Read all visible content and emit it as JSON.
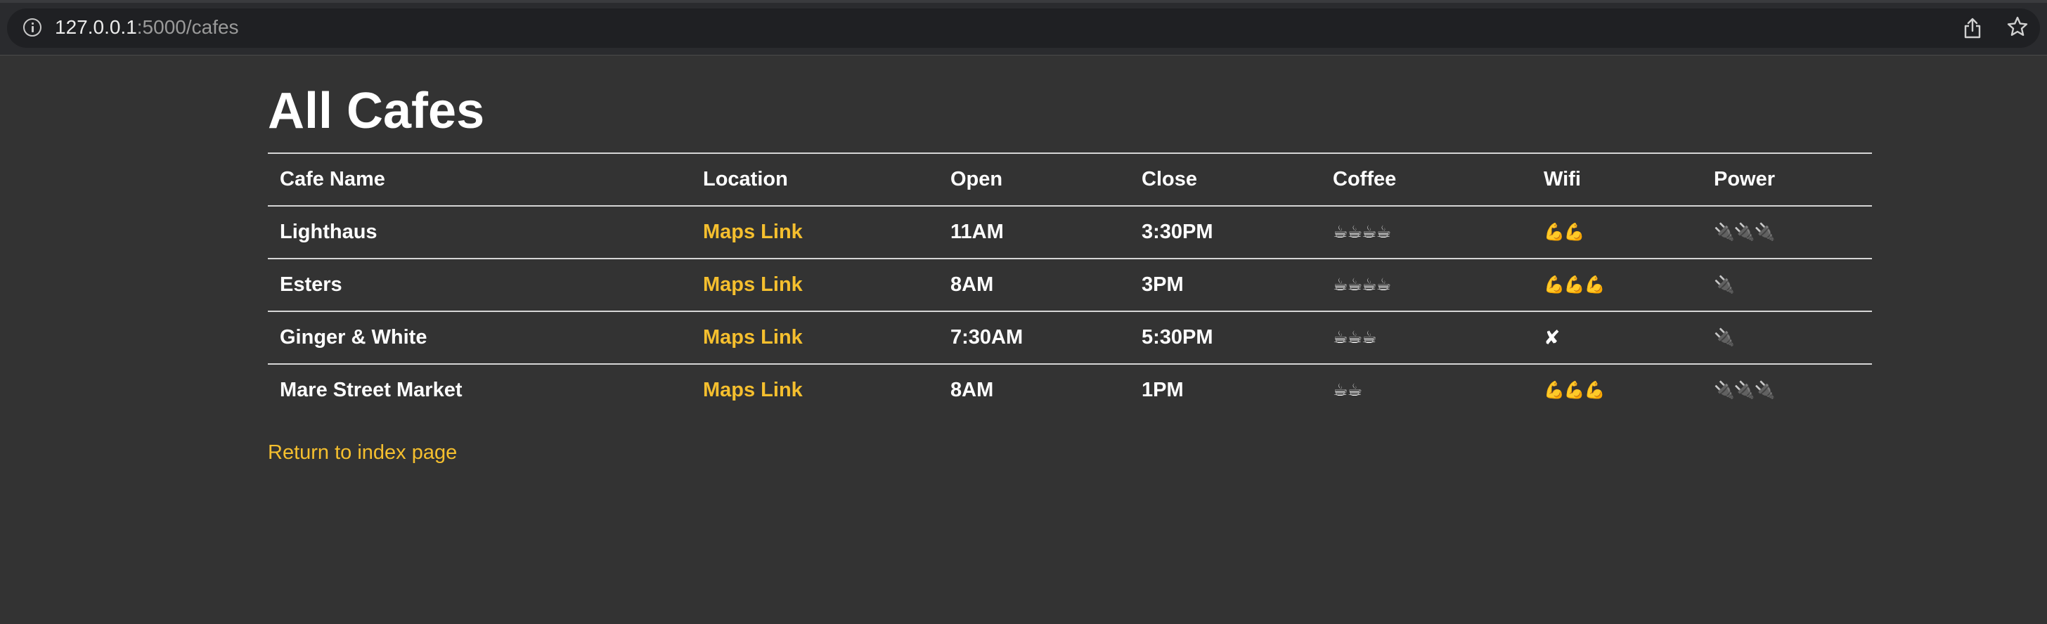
{
  "browser": {
    "url_host": "127.0.0.1",
    "url_rest": ":5000/cafes"
  },
  "page": {
    "title": "All Cafes",
    "return_link": "Return to index page"
  },
  "table": {
    "headers": [
      "Cafe Name",
      "Location",
      "Open",
      "Close",
      "Coffee",
      "Wifi",
      "Power"
    ],
    "rows": [
      {
        "name": "Lighthaus",
        "location": "Maps Link",
        "open": "11AM",
        "close": "3:30PM",
        "coffee": "☕☕☕☕",
        "wifi": "💪💪",
        "power": "🔌🔌🔌"
      },
      {
        "name": "Esters",
        "location": "Maps Link",
        "open": "8AM",
        "close": "3PM",
        "coffee": "☕☕☕☕",
        "wifi": "💪💪💪",
        "power": "🔌"
      },
      {
        "name": "Ginger & White",
        "location": "Maps Link",
        "open": "7:30AM",
        "close": "5:30PM",
        "coffee": "☕☕☕",
        "wifi": "✘",
        "power": "🔌"
      },
      {
        "name": "Mare Street Market",
        "location": "Maps Link",
        "open": "8AM",
        "close": "1PM",
        "coffee": "☕☕",
        "wifi": "💪💪💪",
        "power": "🔌🔌🔌"
      }
    ]
  },
  "colors": {
    "background": "#333333",
    "link": "#f5bf2e",
    "text": "#ffffff"
  },
  "icons": {
    "site_info": "info-icon",
    "share": "share-icon",
    "bookmark": "star-icon"
  }
}
